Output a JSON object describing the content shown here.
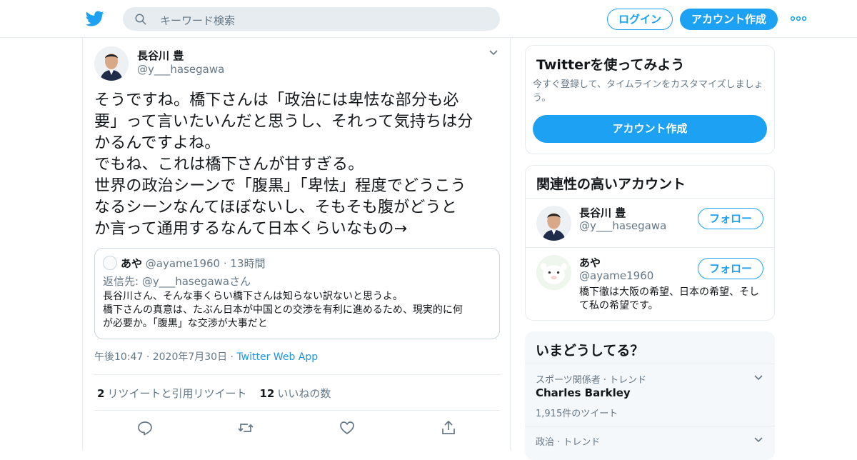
{
  "header": {
    "search_placeholder": "キーワード検索",
    "login": "ログイン",
    "signup": "アカウント作成"
  },
  "tweet": {
    "name": "長谷川 豊",
    "handle": "@y___hasegawa",
    "text": "そうですね。橋下さんは「政治には卑怯な部分も必\n要」って言いたいんだと思うし、それって気持ちは分\nかるんですよね。\nでもね、これは橋下さんが甘すぎる。\n世界の政治シーンで「腹黒」「卑怯」程度でどうこう\nなるシーンなんてほぼないし、そもそも腹がどうと\nか言って通用するなんて日本くらいなもの→",
    "quote": {
      "name": "あや",
      "handle": "@ayame1960",
      "time": "13時間",
      "reply_prefix": "返信先: ",
      "reply_to": "@y___hasegawaさん",
      "text": "長谷川さん、そんな事くらい橋下さんは知らない訳ないと思うよ。\n橋下さんの真意は、たぶん日本が中国との交渉を有利に進めるため、現実的に何\nが必要か。「腹黒」な交渉が大事だと"
    },
    "time": "午後10:47",
    "date": "2020年7月30日",
    "source": "Twitter Web App",
    "retweets_count": "2",
    "retweets_label": "リツイートと引用リツイート",
    "likes_count": "12",
    "likes_label": "いいねの数"
  },
  "sidebar": {
    "try_title": "Twitterを使ってみよう",
    "try_desc": "今すぐ登録して、タイムラインをカスタマイズしましょう。",
    "try_button": "アカウント作成",
    "related_title": "関連性の高いアカウント",
    "accounts": [
      {
        "name": "長谷川 豊",
        "handle": "@y___hasegawa",
        "bio": "",
        "follow": "フォロー"
      },
      {
        "name": "あや",
        "handle": "@ayame1960",
        "bio": "橋下徹は大阪の希望、日本の希望、そして私の希望です。",
        "follow": "フォロー"
      }
    ],
    "trends_title": "いまどうしてる？",
    "trends": [
      {
        "context": "スポーツ関係者 · トレンド",
        "name": "Charles Barkley",
        "count": "1,915件のツイート"
      },
      {
        "context": "政治 · トレンド"
      }
    ]
  },
  "colors": {
    "accent": "#1da1f2",
    "link": "#1b95e0",
    "muted": "#657786",
    "border": "#e6ecf0"
  }
}
